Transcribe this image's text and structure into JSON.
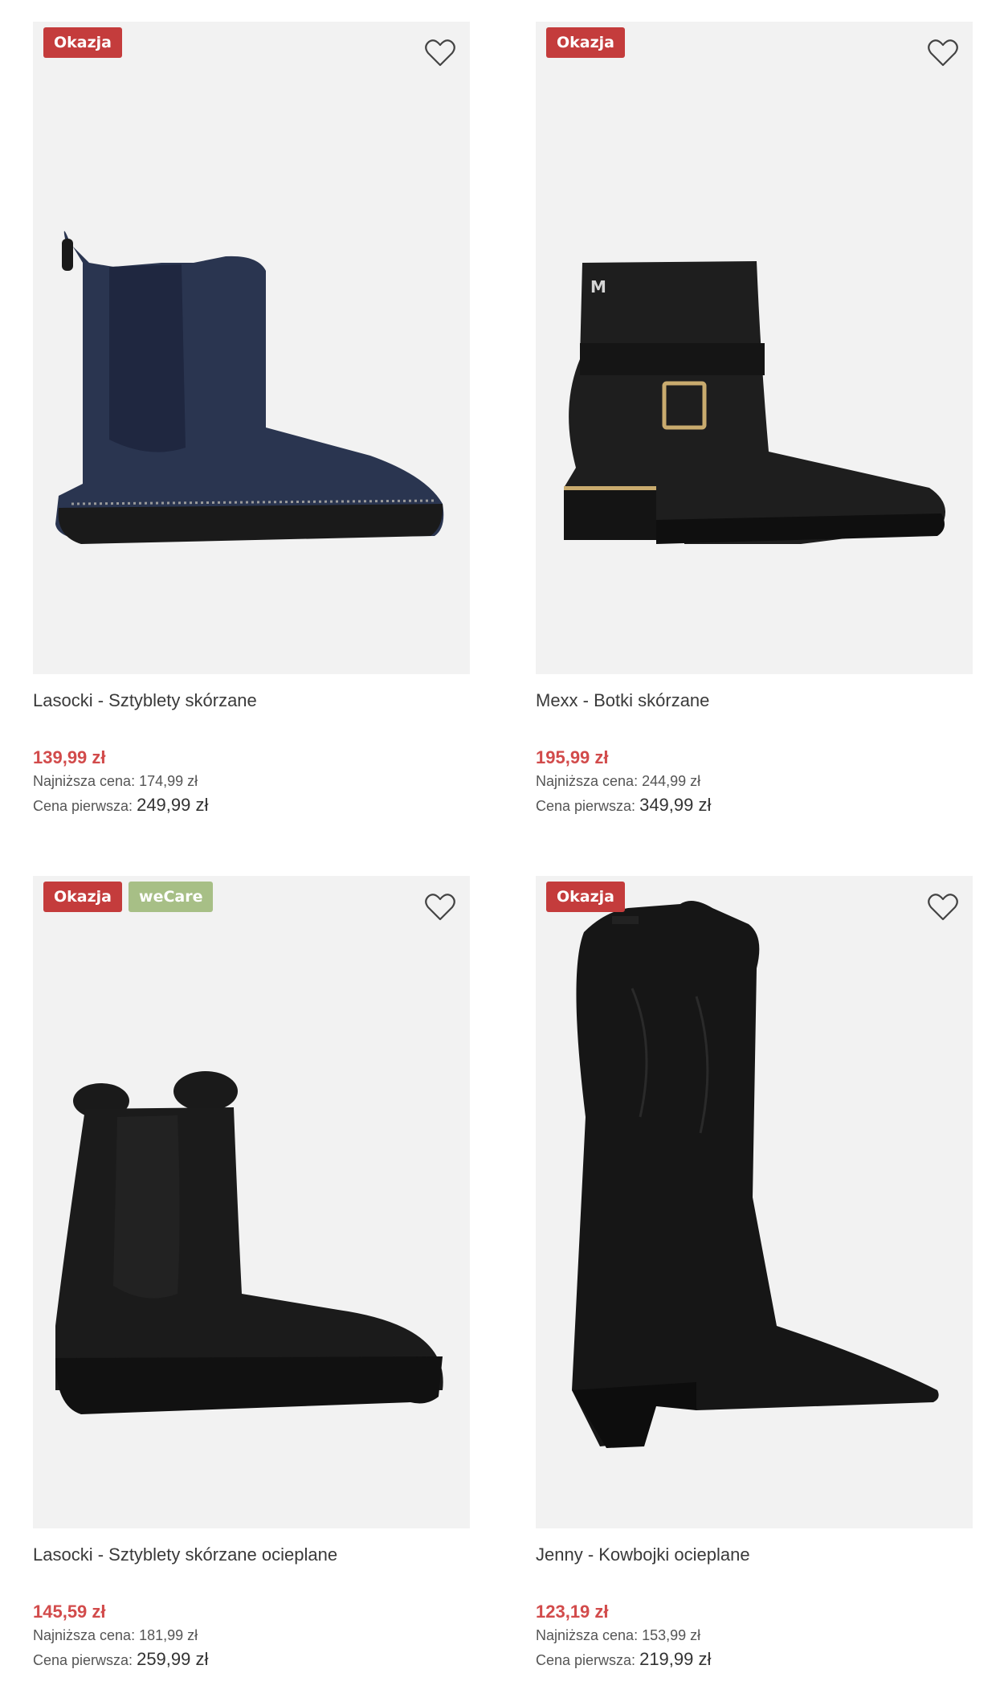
{
  "products": [
    {
      "title": "Lasocki - Sztyblety skórzane",
      "price": "139,99 zł",
      "lowest_label": "Najniższa cena:",
      "lowest_value": "174,99 zł",
      "first_label": "Cena pierwsza:",
      "first_value": "249,99 zł",
      "badges": [
        "Okazja"
      ],
      "boot_color": "#2a3550"
    },
    {
      "title": "Mexx - Botki skórzane",
      "price": "195,99 zł",
      "lowest_label": "Najniższa cena:",
      "lowest_value": "244,99 zł",
      "first_label": "Cena pierwsza:",
      "first_value": "349,99 zł",
      "badges": [
        "Okazja"
      ],
      "boot_color": "#1e1e1e"
    },
    {
      "title": "Lasocki - Sztyblety skórzane ocieplane",
      "price": "145,59 zł",
      "lowest_label": "Najniższa cena:",
      "lowest_value": "181,99 zł",
      "first_label": "Cena pierwsza:",
      "first_value": "259,99 zł",
      "badges": [
        "Okazja",
        "weCare"
      ],
      "boot_color": "#1b1b1b"
    },
    {
      "title": "Jenny - Kowbojki ocieplane",
      "price": "123,19 zł",
      "lowest_label": "Najniższa cena:",
      "lowest_value": "153,99 zł",
      "first_label": "Cena pierwsza:",
      "first_value": "219,99 zł",
      "badges": [
        "Okazja"
      ],
      "boot_color": "#161616"
    }
  ],
  "icons": {
    "wishlist": "heart-outline-icon"
  },
  "colors": {
    "sale_badge": "#c43c3c",
    "wecare_badge": "#a7bf86",
    "price_red": "#d24b4b",
    "image_bg": "#f2f2f2"
  }
}
